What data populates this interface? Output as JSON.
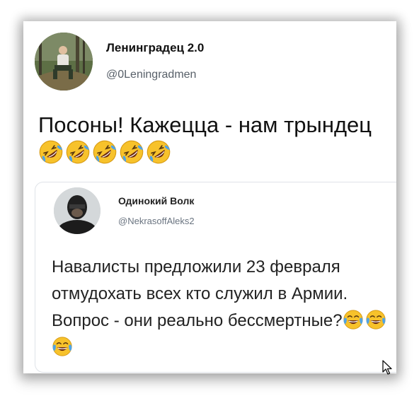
{
  "tweet": {
    "author_name": "Ленинградец 2.0",
    "author_handle": "@0Leningradmen",
    "text": "Посоны! Кажецца - нам трындец",
    "emoji_name": "rolling-on-floor-laughing-icon",
    "emoji_count": 5
  },
  "quoted_tweet": {
    "author_name": "Одинокий Волк",
    "author_handle": "@NekrasoffAleks2",
    "text": "Навалисты предложили 23 февраля отмудохать всех кто служил в Армии. Вопрос - они реально бессмертные?",
    "emoji_name": "tears-of-joy-icon",
    "emoji_count": 3
  },
  "colors": {
    "text": "#111111",
    "handle": "#586069",
    "quote_border": "#dfe3e8",
    "emoji_face": "#f7c22b"
  }
}
